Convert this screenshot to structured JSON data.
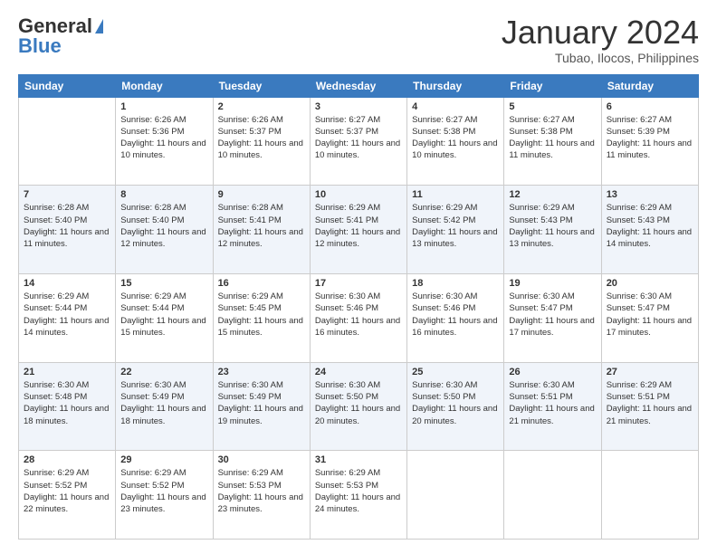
{
  "header": {
    "logo_line1": "General",
    "logo_line2": "Blue",
    "month": "January 2024",
    "location": "Tubao, Ilocos, Philippines"
  },
  "weekdays": [
    "Sunday",
    "Monday",
    "Tuesday",
    "Wednesday",
    "Thursday",
    "Friday",
    "Saturday"
  ],
  "weeks": [
    [
      {
        "day": "",
        "sunrise": "",
        "sunset": "",
        "daylight": ""
      },
      {
        "day": "1",
        "sunrise": "Sunrise: 6:26 AM",
        "sunset": "Sunset: 5:36 PM",
        "daylight": "Daylight: 11 hours and 10 minutes."
      },
      {
        "day": "2",
        "sunrise": "Sunrise: 6:26 AM",
        "sunset": "Sunset: 5:37 PM",
        "daylight": "Daylight: 11 hours and 10 minutes."
      },
      {
        "day": "3",
        "sunrise": "Sunrise: 6:27 AM",
        "sunset": "Sunset: 5:37 PM",
        "daylight": "Daylight: 11 hours and 10 minutes."
      },
      {
        "day": "4",
        "sunrise": "Sunrise: 6:27 AM",
        "sunset": "Sunset: 5:38 PM",
        "daylight": "Daylight: 11 hours and 10 minutes."
      },
      {
        "day": "5",
        "sunrise": "Sunrise: 6:27 AM",
        "sunset": "Sunset: 5:38 PM",
        "daylight": "Daylight: 11 hours and 11 minutes."
      },
      {
        "day": "6",
        "sunrise": "Sunrise: 6:27 AM",
        "sunset": "Sunset: 5:39 PM",
        "daylight": "Daylight: 11 hours and 11 minutes."
      }
    ],
    [
      {
        "day": "7",
        "sunrise": "Sunrise: 6:28 AM",
        "sunset": "Sunset: 5:40 PM",
        "daylight": "Daylight: 11 hours and 11 minutes."
      },
      {
        "day": "8",
        "sunrise": "Sunrise: 6:28 AM",
        "sunset": "Sunset: 5:40 PM",
        "daylight": "Daylight: 11 hours and 12 minutes."
      },
      {
        "day": "9",
        "sunrise": "Sunrise: 6:28 AM",
        "sunset": "Sunset: 5:41 PM",
        "daylight": "Daylight: 11 hours and 12 minutes."
      },
      {
        "day": "10",
        "sunrise": "Sunrise: 6:29 AM",
        "sunset": "Sunset: 5:41 PM",
        "daylight": "Daylight: 11 hours and 12 minutes."
      },
      {
        "day": "11",
        "sunrise": "Sunrise: 6:29 AM",
        "sunset": "Sunset: 5:42 PM",
        "daylight": "Daylight: 11 hours and 13 minutes."
      },
      {
        "day": "12",
        "sunrise": "Sunrise: 6:29 AM",
        "sunset": "Sunset: 5:43 PM",
        "daylight": "Daylight: 11 hours and 13 minutes."
      },
      {
        "day": "13",
        "sunrise": "Sunrise: 6:29 AM",
        "sunset": "Sunset: 5:43 PM",
        "daylight": "Daylight: 11 hours and 14 minutes."
      }
    ],
    [
      {
        "day": "14",
        "sunrise": "Sunrise: 6:29 AM",
        "sunset": "Sunset: 5:44 PM",
        "daylight": "Daylight: 11 hours and 14 minutes."
      },
      {
        "day": "15",
        "sunrise": "Sunrise: 6:29 AM",
        "sunset": "Sunset: 5:44 PM",
        "daylight": "Daylight: 11 hours and 15 minutes."
      },
      {
        "day": "16",
        "sunrise": "Sunrise: 6:29 AM",
        "sunset": "Sunset: 5:45 PM",
        "daylight": "Daylight: 11 hours and 15 minutes."
      },
      {
        "day": "17",
        "sunrise": "Sunrise: 6:30 AM",
        "sunset": "Sunset: 5:46 PM",
        "daylight": "Daylight: 11 hours and 16 minutes."
      },
      {
        "day": "18",
        "sunrise": "Sunrise: 6:30 AM",
        "sunset": "Sunset: 5:46 PM",
        "daylight": "Daylight: 11 hours and 16 minutes."
      },
      {
        "day": "19",
        "sunrise": "Sunrise: 6:30 AM",
        "sunset": "Sunset: 5:47 PM",
        "daylight": "Daylight: 11 hours and 17 minutes."
      },
      {
        "day": "20",
        "sunrise": "Sunrise: 6:30 AM",
        "sunset": "Sunset: 5:47 PM",
        "daylight": "Daylight: 11 hours and 17 minutes."
      }
    ],
    [
      {
        "day": "21",
        "sunrise": "Sunrise: 6:30 AM",
        "sunset": "Sunset: 5:48 PM",
        "daylight": "Daylight: 11 hours and 18 minutes."
      },
      {
        "day": "22",
        "sunrise": "Sunrise: 6:30 AM",
        "sunset": "Sunset: 5:49 PM",
        "daylight": "Daylight: 11 hours and 18 minutes."
      },
      {
        "day": "23",
        "sunrise": "Sunrise: 6:30 AM",
        "sunset": "Sunset: 5:49 PM",
        "daylight": "Daylight: 11 hours and 19 minutes."
      },
      {
        "day": "24",
        "sunrise": "Sunrise: 6:30 AM",
        "sunset": "Sunset: 5:50 PM",
        "daylight": "Daylight: 11 hours and 20 minutes."
      },
      {
        "day": "25",
        "sunrise": "Sunrise: 6:30 AM",
        "sunset": "Sunset: 5:50 PM",
        "daylight": "Daylight: 11 hours and 20 minutes."
      },
      {
        "day": "26",
        "sunrise": "Sunrise: 6:30 AM",
        "sunset": "Sunset: 5:51 PM",
        "daylight": "Daylight: 11 hours and 21 minutes."
      },
      {
        "day": "27",
        "sunrise": "Sunrise: 6:29 AM",
        "sunset": "Sunset: 5:51 PM",
        "daylight": "Daylight: 11 hours and 21 minutes."
      }
    ],
    [
      {
        "day": "28",
        "sunrise": "Sunrise: 6:29 AM",
        "sunset": "Sunset: 5:52 PM",
        "daylight": "Daylight: 11 hours and 22 minutes."
      },
      {
        "day": "29",
        "sunrise": "Sunrise: 6:29 AM",
        "sunset": "Sunset: 5:52 PM",
        "daylight": "Daylight: 11 hours and 23 minutes."
      },
      {
        "day": "30",
        "sunrise": "Sunrise: 6:29 AM",
        "sunset": "Sunset: 5:53 PM",
        "daylight": "Daylight: 11 hours and 23 minutes."
      },
      {
        "day": "31",
        "sunrise": "Sunrise: 6:29 AM",
        "sunset": "Sunset: 5:53 PM",
        "daylight": "Daylight: 11 hours and 24 minutes."
      },
      {
        "day": "",
        "sunrise": "",
        "sunset": "",
        "daylight": ""
      },
      {
        "day": "",
        "sunrise": "",
        "sunset": "",
        "daylight": ""
      },
      {
        "day": "",
        "sunrise": "",
        "sunset": "",
        "daylight": ""
      }
    ]
  ]
}
